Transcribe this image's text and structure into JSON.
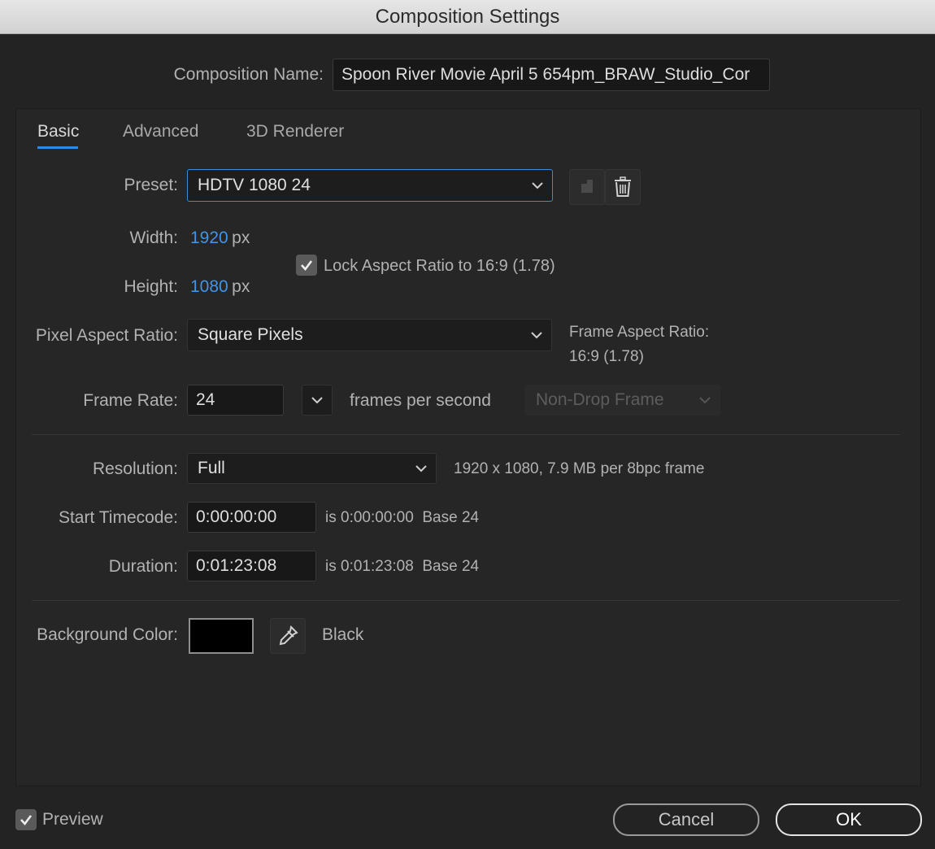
{
  "window": {
    "title": "Composition Settings"
  },
  "composition_name": {
    "label": "Composition Name:",
    "value": "Spoon River Movie April 5 654pm_BRAW_Studio_Cor"
  },
  "tabs": [
    {
      "label": "Basic",
      "active": true
    },
    {
      "label": "Advanced",
      "active": false
    },
    {
      "label": "3D Renderer",
      "active": false
    }
  ],
  "preset": {
    "label": "Preset:",
    "value": "HDTV 1080 24"
  },
  "width": {
    "label": "Width:",
    "value": "1920",
    "unit": "px"
  },
  "height": {
    "label": "Height:",
    "value": "1080",
    "unit": "px"
  },
  "lock_aspect": {
    "checked": true,
    "label": "Lock Aspect Ratio to 16:9 (1.78)"
  },
  "pixel_aspect": {
    "label": "Pixel Aspect Ratio:",
    "value": "Square Pixels"
  },
  "frame_aspect": {
    "label": "Frame Aspect Ratio:",
    "value": "16:9 (1.78)"
  },
  "frame_rate": {
    "label": "Frame Rate:",
    "value": "24",
    "unit_label": "frames per second",
    "drop_frame": "Non-Drop Frame"
  },
  "resolution": {
    "label": "Resolution:",
    "value": "Full",
    "info": "1920 x 1080, 7.9 MB per 8bpc frame"
  },
  "start_timecode": {
    "label": "Start Timecode:",
    "value": "0:00:00:00",
    "info": "is 0:00:00:00  Base 24"
  },
  "duration": {
    "label": "Duration:",
    "value": "0:01:23:08",
    "info": "is 0:01:23:08  Base 24"
  },
  "background_color": {
    "label": "Background Color:",
    "swatch": "#000000",
    "name": "Black"
  },
  "preview": {
    "checked": true,
    "label": "Preview"
  },
  "buttons": {
    "cancel": "Cancel",
    "ok": "OK"
  },
  "colors": {
    "accent": "#2d8ceb",
    "value_blue": "#3e95ea"
  }
}
